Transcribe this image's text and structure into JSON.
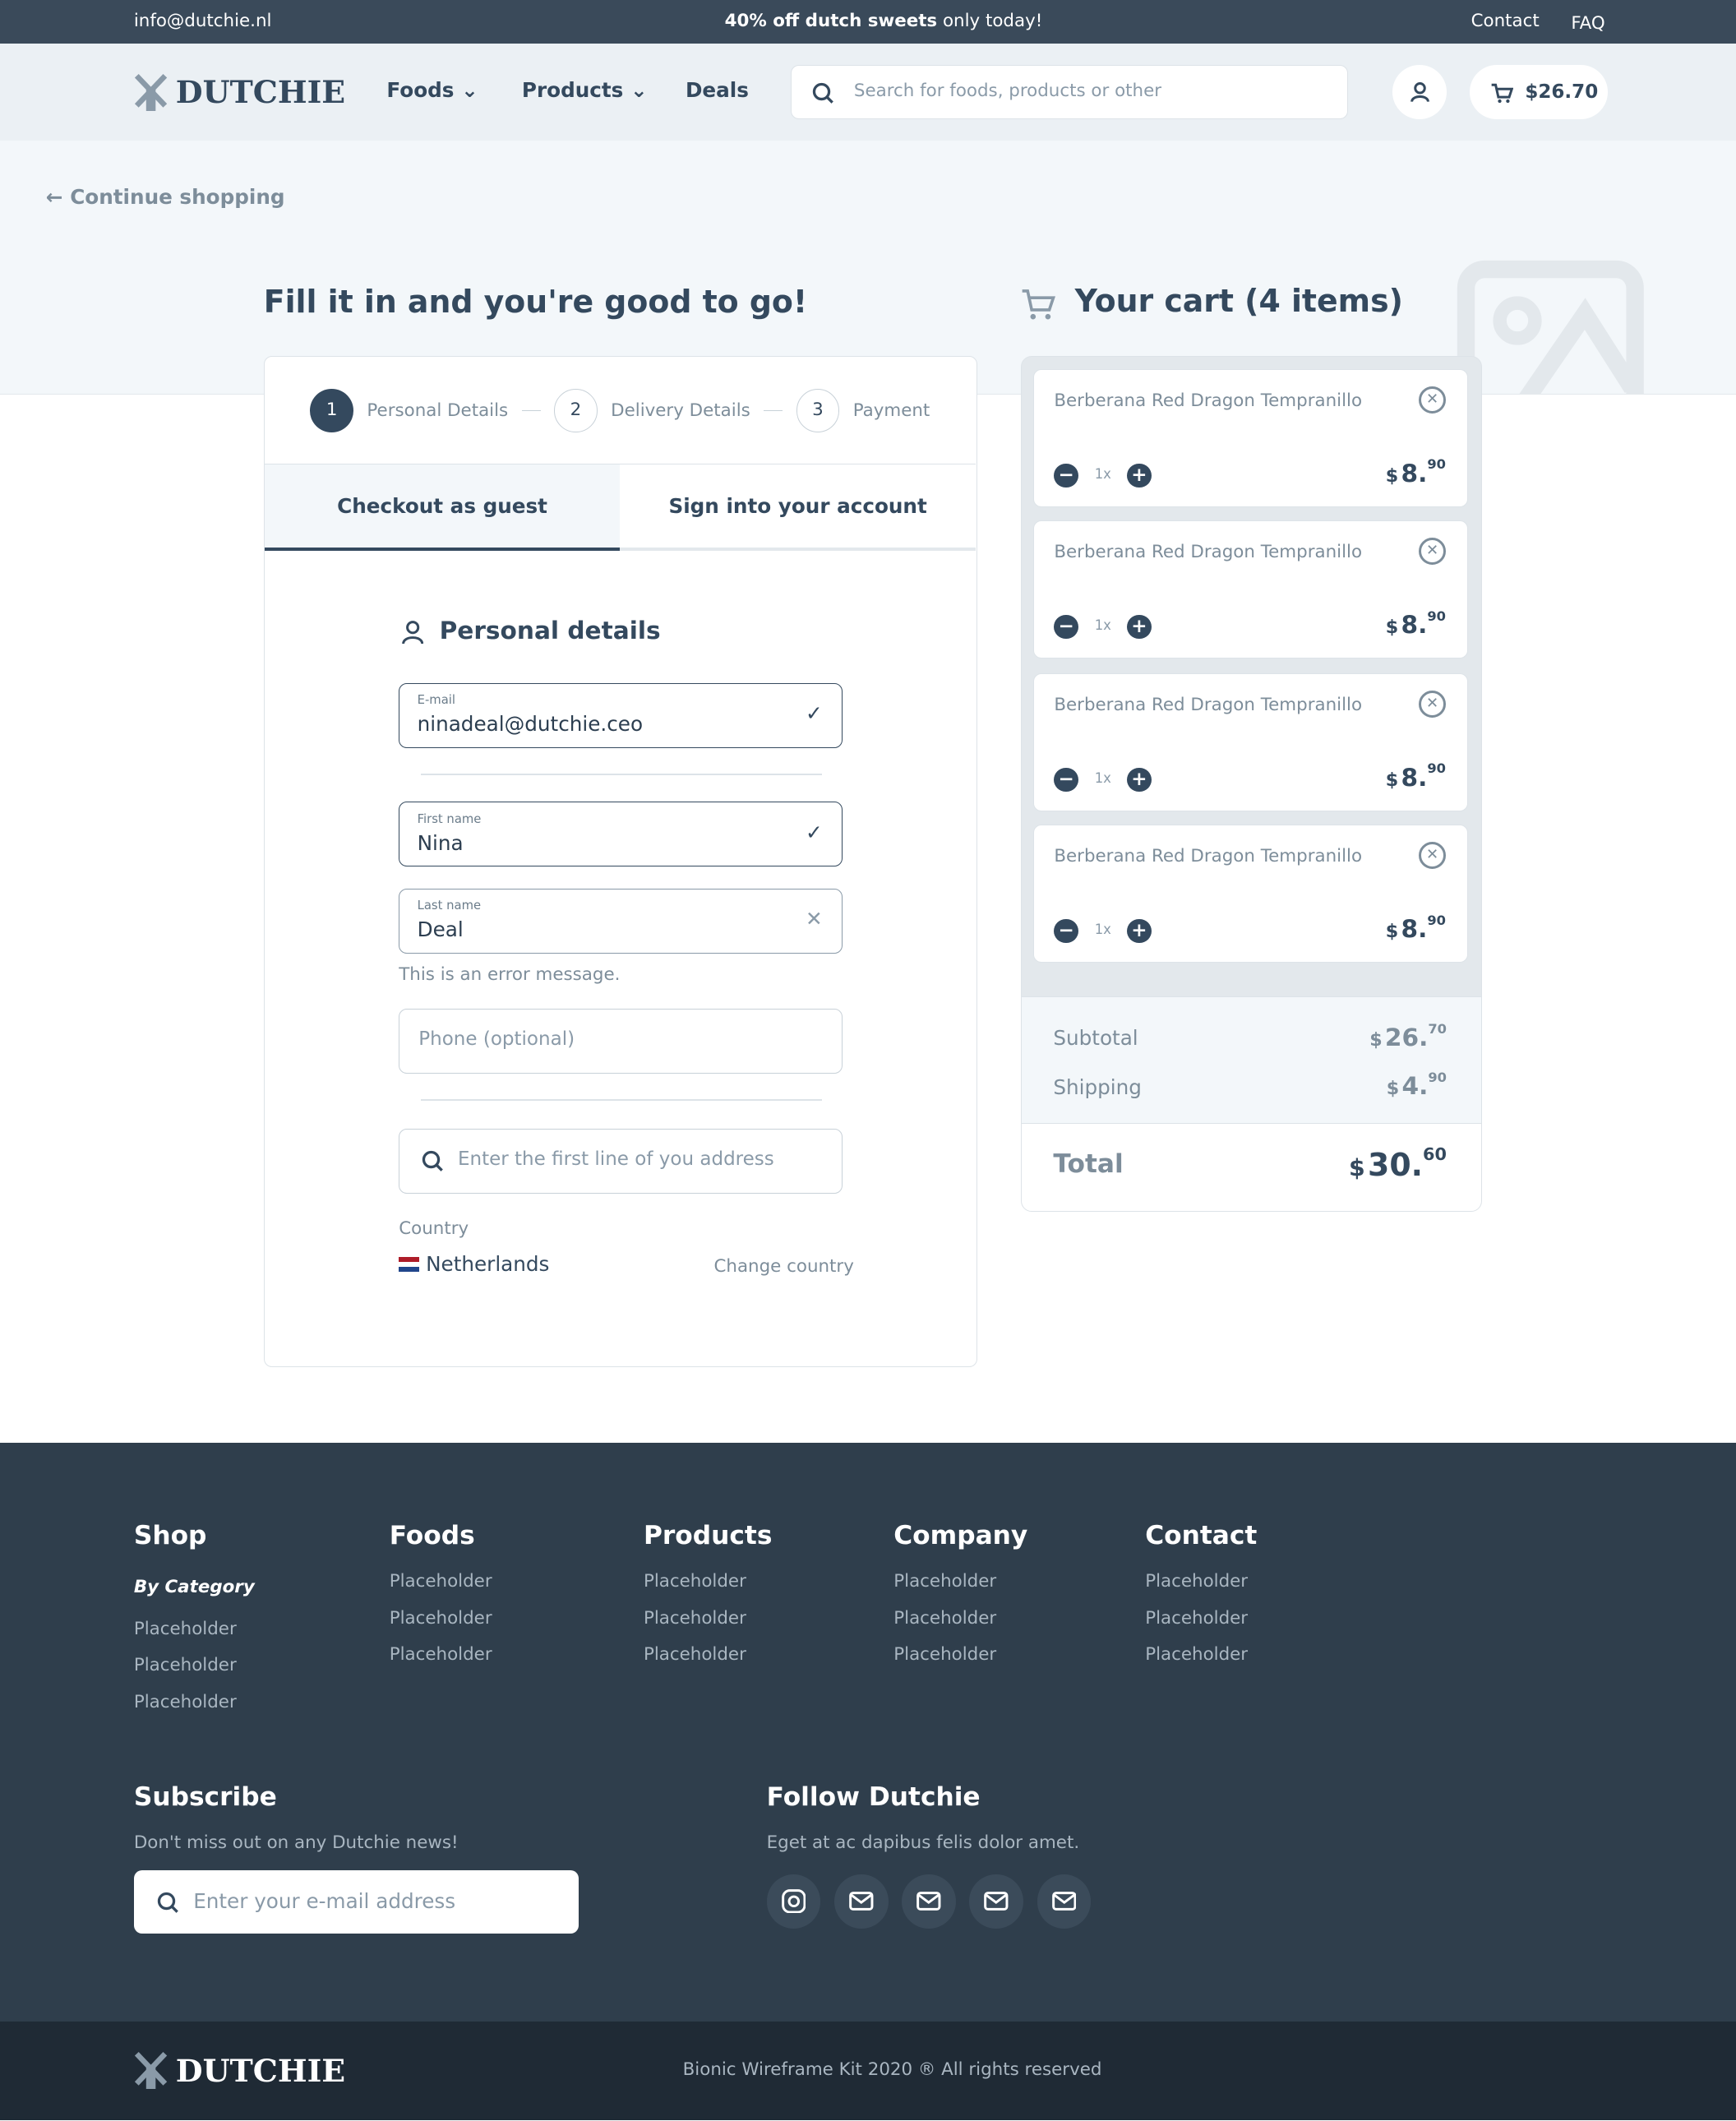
{
  "topbar": {
    "email": "info@dutchie.nl",
    "promo_bold": "40% off dutch sweets",
    "promo_rest": " only today!",
    "contact": "Contact",
    "faq": "FAQ"
  },
  "header": {
    "logo": "DUTCHIE",
    "nav": [
      {
        "label": "Foods"
      },
      {
        "label": "Products"
      },
      {
        "label": "Deals"
      }
    ],
    "search_placeholder": "Search for foods, products or other",
    "cart_total": "$26.70"
  },
  "continue_shopping": "Continue shopping",
  "checkout": {
    "title": "Fill it in and you're good to go!",
    "steps": [
      {
        "num": "1",
        "label": "Personal Details",
        "active": true
      },
      {
        "num": "2",
        "label": "Delivery Details"
      },
      {
        "num": "3",
        "label": "Payment"
      }
    ],
    "tabs": [
      {
        "label": "Checkout as guest",
        "active": true
      },
      {
        "label": "Sign into your account"
      }
    ],
    "section_title": "Personal details",
    "email": {
      "label": "E-mail",
      "value": "ninadeal@dutchie.ceo"
    },
    "first_name": {
      "label": "First name",
      "value": "Nina"
    },
    "last_name": {
      "label": "Last name",
      "value": "Deal",
      "error": "This is an error message."
    },
    "phone_placeholder": "Phone (optional)",
    "address_placeholder": "Enter the first line of you address",
    "country_label": "Country",
    "country": "Netherlands",
    "change_country": "Change country"
  },
  "cart": {
    "title": "Your cart (4 items)",
    "items": [
      {
        "name": "Berberana Red Dragon Tempranillo",
        "qty": "1x",
        "price_main": "8.",
        "price_cents": "90"
      },
      {
        "name": "Berberana Red Dragon Tempranillo",
        "qty": "1x",
        "price_main": "8.",
        "price_cents": "90"
      },
      {
        "name": "Berberana Red Dragon Tempranillo",
        "qty": "1x",
        "price_main": "8.",
        "price_cents": "90"
      },
      {
        "name": "Berberana Red Dragon Tempranillo",
        "qty": "1x",
        "price_main": "8.",
        "price_cents": "90"
      }
    ],
    "currency": "$",
    "subtotal_label": "Subtotal",
    "subtotal_main": "26.",
    "subtotal_cents": "70",
    "shipping_label": "Shipping",
    "shipping_main": "4.",
    "shipping_cents": "90",
    "total_label": "Total",
    "total_main": "30.",
    "total_cents": "60"
  },
  "footer": {
    "columns": [
      {
        "title": "Shop",
        "subtitle": "By Category",
        "items": [
          "Placeholder",
          "Placeholder",
          "Placeholder"
        ]
      },
      {
        "title": "Foods",
        "items": [
          "Placeholder",
          "Placeholder",
          "Placeholder"
        ]
      },
      {
        "title": "Products",
        "items": [
          "Placeholder",
          "Placeholder",
          "Placeholder"
        ]
      },
      {
        "title": "Company",
        "items": [
          "Placeholder",
          "Placeholder",
          "Placeholder"
        ]
      },
      {
        "title": "Contact",
        "items": [
          "Placeholder",
          "Placeholder",
          "Placeholder"
        ]
      }
    ],
    "subscribe_title": "Subscribe",
    "subscribe_text": "Don't miss out on any Dutchie news!",
    "subscribe_placeholder": "Enter your e-mail address",
    "follow_title": "Follow Dutchie",
    "follow_text": "Eget at ac dapibus felis dolor amet.",
    "social": [
      "instagram-icon",
      "mail-icon",
      "mail-icon",
      "mail-icon",
      "mail-icon"
    ],
    "copyright": "Bionic Wireframe Kit 2020 ® All rights reserved"
  },
  "colors": {
    "dark": "#34495e",
    "footer": "#2f3e4c",
    "bottom": "#1f2a35",
    "hero": "#f3f7fa"
  }
}
